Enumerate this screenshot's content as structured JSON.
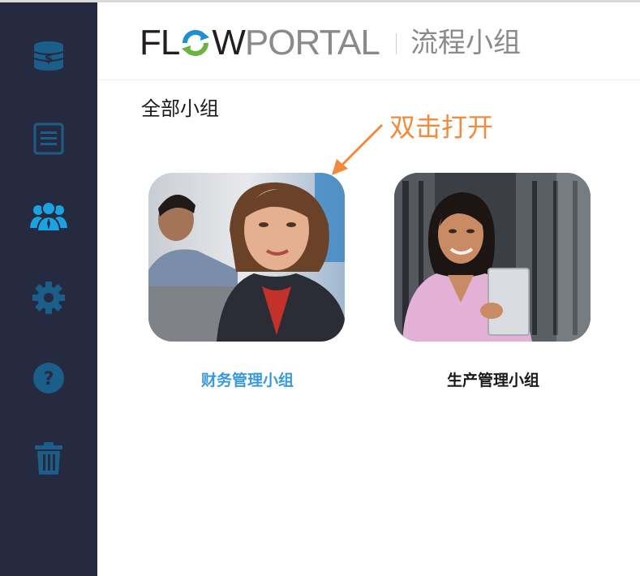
{
  "app": {
    "logo_part1": "FL",
    "logo_part2": "W",
    "logo_part3": "PORTAL",
    "header_title": "流程小组"
  },
  "sidebar": {
    "items": [
      {
        "icon": "coins-icon",
        "label": ""
      },
      {
        "icon": "document-list-icon",
        "label": ""
      },
      {
        "icon": "users-group-icon",
        "label": "",
        "active": true
      },
      {
        "icon": "gear-icon",
        "label": ""
      },
      {
        "icon": "help-icon",
        "label": ""
      },
      {
        "icon": "trash-icon",
        "label": ""
      }
    ]
  },
  "main": {
    "section_title": "全部小组",
    "annotation": "双击打开",
    "groups": [
      {
        "name": "财务管理小组",
        "selected": true,
        "name_color": "#3a9ad9"
      },
      {
        "name": "生产管理小组",
        "selected": false,
        "name_color": "#1a1a1a"
      }
    ]
  },
  "colors": {
    "sidebar_bg": "#262a41",
    "sidebar_icon": "#1c5e8a",
    "sidebar_icon_active": "#1aa3e0",
    "annotation": "#f08a3c",
    "accent": "#3a9ad9"
  }
}
